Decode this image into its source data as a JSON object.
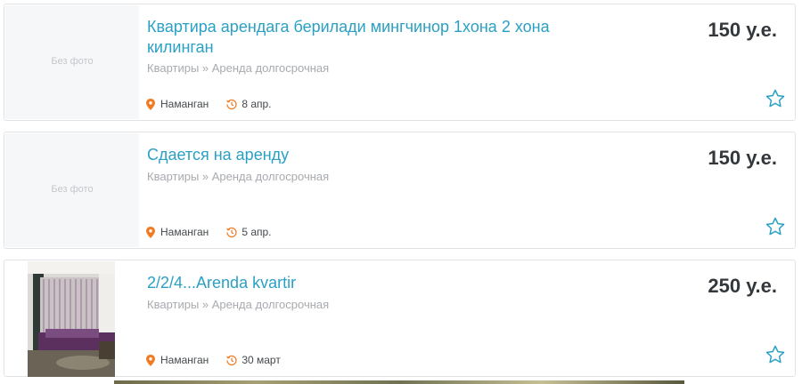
{
  "colors": {
    "title": "#2aa0c5",
    "price": "#33383c",
    "category": "#a7abaf",
    "location_icon": "#f07b22",
    "date_icon": "#f07b22",
    "star": "#2aa0c5"
  },
  "listings": [
    {
      "title": "Квартира арендага берилади мингчинор 1хона 2 хона килинган",
      "category": "Квартиры » Аренда долгосрочная",
      "location": "Наманган",
      "date": "8 апр.",
      "price": "150 у.е.",
      "photo": "Без фото",
      "location_icon": "map-pin-icon",
      "date_icon": "history-clock-icon",
      "favorite_icon": "star-outline-icon"
    },
    {
      "title": "Сдается на аренду",
      "category": "Квартиры » Аренда долгосрочная",
      "location": "Наманган",
      "date": "5 апр.",
      "price": "150 у.е.",
      "photo": "Без фото",
      "location_icon": "map-pin-icon",
      "date_icon": "history-clock-icon",
      "favorite_icon": "star-outline-icon"
    },
    {
      "title": "2/2/4...Arenda kvartir",
      "category": "Квартиры » Аренда долгосрочная",
      "location": "Наманган",
      "date": "30 март",
      "price": "250 у.е.",
      "location_icon": "map-pin-icon",
      "date_icon": "history-clock-icon",
      "favorite_icon": "star-outline-icon"
    }
  ]
}
